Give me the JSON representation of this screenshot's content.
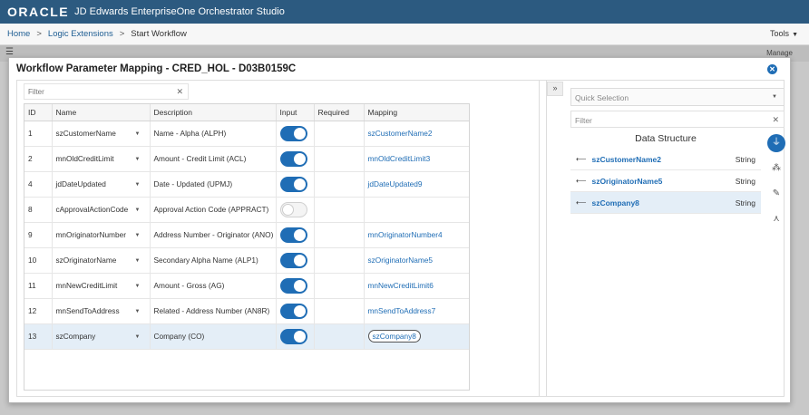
{
  "app": {
    "logo": "ORACLE",
    "title": "JD Edwards EnterpriseOne Orchestrator Studio"
  },
  "breadcrumb": {
    "items": [
      "Home",
      "Logic Extensions"
    ],
    "separator": ">",
    "current": "Start Workflow"
  },
  "tools_label": "Tools",
  "underlay": {
    "manage_label": "Manage"
  },
  "dialog": {
    "title": "Workflow Parameter Mapping - CRED_HOL - D03B0159C",
    "filter_placeholder": "Filter",
    "columns": [
      "ID",
      "Name",
      "Description",
      "Input",
      "Required",
      "Mapping"
    ],
    "rows": [
      {
        "id": "1",
        "name": "szCustomerName",
        "description": "Name - Alpha (ALPH)",
        "input": true,
        "required": "",
        "mapping": "szCustomerName2"
      },
      {
        "id": "2",
        "name": "mnOldCreditLimit",
        "description": "Amount - Credit Limit (ACL)",
        "input": true,
        "required": "",
        "mapping": "mnOldCreditLimit3"
      },
      {
        "id": "4",
        "name": "jdDateUpdated",
        "description": "Date - Updated (UPMJ)",
        "input": true,
        "required": "",
        "mapping": "jdDateUpdated9"
      },
      {
        "id": "8",
        "name": "cApprovalActionCode",
        "description": "Approval Action Code (APPRACT)",
        "input": false,
        "required": "",
        "mapping": ""
      },
      {
        "id": "9",
        "name": "mnOriginatorNumber",
        "description": "Address Number - Originator (ANO)",
        "input": true,
        "required": "",
        "mapping": "mnOriginatorNumber4"
      },
      {
        "id": "10",
        "name": "szOriginatorName",
        "description": "Secondary Alpha Name (ALP1)",
        "input": true,
        "required": "",
        "mapping": "szOriginatorName5"
      },
      {
        "id": "11",
        "name": "mnNewCreditLimit",
        "description": "Amount - Gross (AG)",
        "input": true,
        "required": "",
        "mapping": "mnNewCreditLimit6"
      },
      {
        "id": "12",
        "name": "mnSendToAddress",
        "description": "Related - Address Number (AN8R)",
        "input": true,
        "required": "",
        "mapping": "mnSendToAddress7"
      },
      {
        "id": "13",
        "name": "szCompany",
        "description": "Company (CO)",
        "input": true,
        "required": "",
        "mapping": "szCompany8",
        "selected": true
      }
    ]
  },
  "right_pane": {
    "collapse_label": "»",
    "quick_selection_placeholder": "Quick Selection",
    "filter_placeholder": "Filter",
    "data_structure_title": "Data Structure",
    "fields": [
      {
        "name": "szCustomerName2",
        "type": "String"
      },
      {
        "name": "szOriginatorName5",
        "type": "String"
      },
      {
        "name": "szCompany8",
        "type": "String",
        "selected": true
      }
    ],
    "side_icons": [
      "plug-icon",
      "network-icon",
      "edit-icon",
      "split-icon"
    ]
  },
  "colors": {
    "header": "#2c5a80",
    "accent": "#1f6db5",
    "selected_row": "#e4eef7"
  }
}
